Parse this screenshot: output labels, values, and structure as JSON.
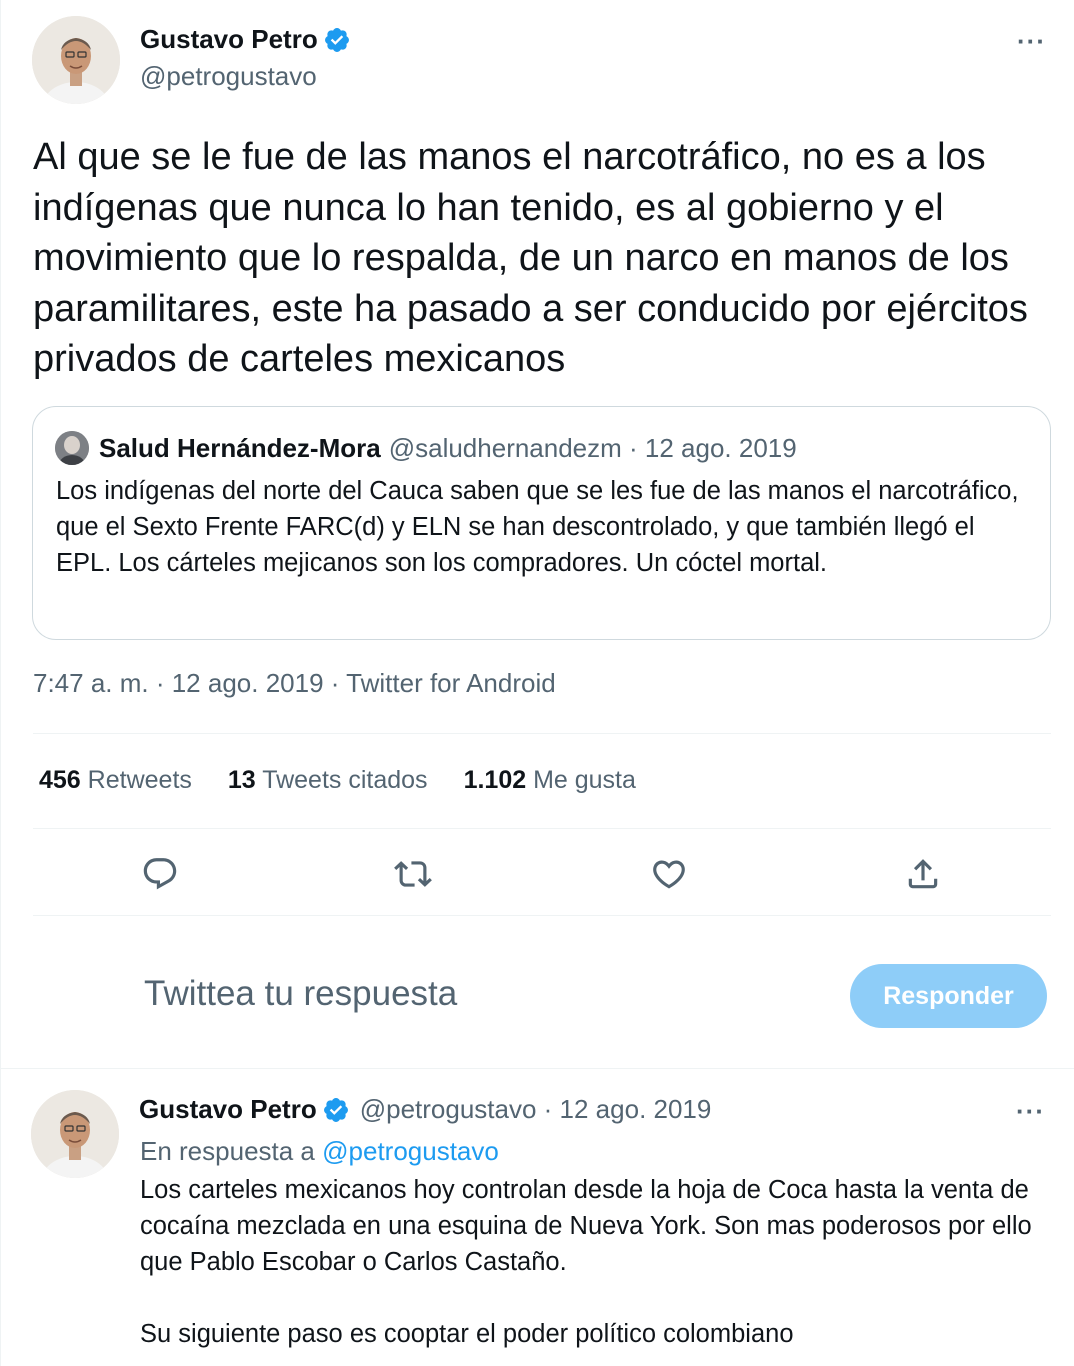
{
  "main_tweet": {
    "author_name": "Gustavo Petro",
    "author_handle": "@petrogustavo",
    "avatar_icon": "profile-photo",
    "more_label": "···",
    "text": "Al que se le fue de las manos el narcotráfico, no es a los indígenas que nunca lo han tenido, es al gobierno y el movimiento que lo respalda, de un narco en manos de los paramilitares, este ha pasado a ser conducido por ejércitos privados de carteles mexicanos",
    "quote": {
      "author_name": "Salud Hernández-Mora",
      "meta": "@saludhernandezm · 12 ago. 2019",
      "text": "Los indígenas del norte del Cauca saben que se les fue de las manos el narcotráfico, que el Sexto Frente FARC(d) y ELN se han descontrolado, y que también llegó el EPL. Los cárteles mejicanos son los compradores. Un cóctel mortal."
    },
    "timestamp": "7:47 a. m. · 12 ago. 2019 · Twitter for Android",
    "stats": {
      "retweets_count": "456",
      "retweets_label": "Retweets",
      "quotes_count": "13",
      "quotes_label": "Tweets citados",
      "likes_count": "1.102",
      "likes_label": "Me gusta"
    },
    "actions": [
      "reply-icon",
      "retweet-icon",
      "like-icon",
      "share-icon"
    ]
  },
  "reply_box": {
    "placeholder": "Twittea tu respuesta",
    "button_label": "Responder",
    "button_color": "#8ecdf8"
  },
  "reply_tweet": {
    "author_name": "Gustavo Petro",
    "meta": "@petrogustavo · 12 ago. 2019",
    "more_label": "···",
    "in_reply_prefix": "En respuesta a",
    "in_reply_handle": "@petrogustavo",
    "text": "Los carteles mexicanos hoy controlan desde la hoja de Coca hasta la venta de cocaína mezclada en una esquina de Nueva York. Son mas poderosos por ello que Pablo Escobar o Carlos Castaño.\n\nSu siguiente paso es cooptar el poder político colombiano"
  },
  "colors": {
    "accent": "#1d9bf0",
    "text": "#0f1419",
    "secondary": "#536471",
    "border": "#cfd9de"
  }
}
